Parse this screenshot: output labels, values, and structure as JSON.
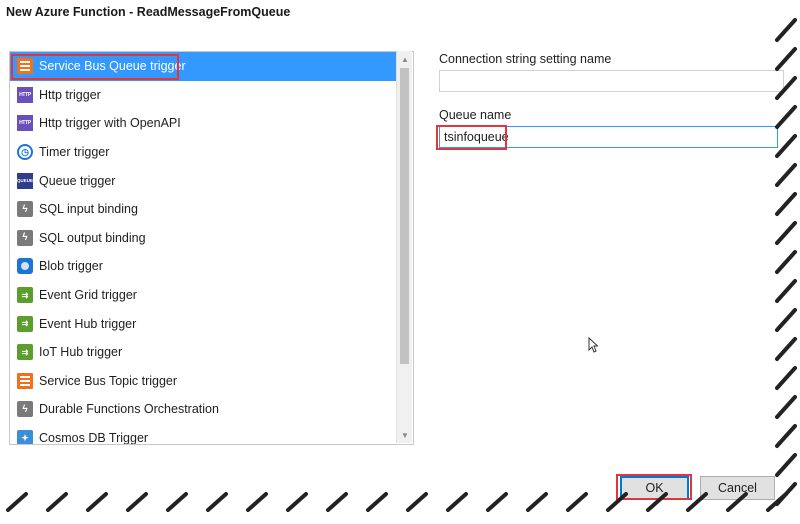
{
  "dialog": {
    "title": "New Azure Function - ReadMessageFromQueue"
  },
  "trigger_list": {
    "selected_index": 0,
    "items": [
      {
        "label": "Service Bus Queue trigger",
        "icon": "service-bus-icon"
      },
      {
        "label": "Http trigger",
        "icon": "http-icon"
      },
      {
        "label": "Http trigger with OpenAPI",
        "icon": "http-icon"
      },
      {
        "label": "Timer trigger",
        "icon": "timer-icon"
      },
      {
        "label": "Queue trigger",
        "icon": "queue-icon"
      },
      {
        "label": "SQL input binding",
        "icon": "sql-icon"
      },
      {
        "label": "SQL output binding",
        "icon": "sql-icon"
      },
      {
        "label": "Blob trigger",
        "icon": "blob-icon"
      },
      {
        "label": "Event Grid trigger",
        "icon": "event-grid-icon"
      },
      {
        "label": "Event Hub trigger",
        "icon": "event-hub-icon"
      },
      {
        "label": "IoT Hub trigger",
        "icon": "iot-hub-icon"
      },
      {
        "label": "Service Bus Topic trigger",
        "icon": "service-bus-icon"
      },
      {
        "label": "Durable Functions Orchestration",
        "icon": "durable-functions-icon"
      },
      {
        "label": "Cosmos DB Trigger",
        "icon": "cosmos-db-icon"
      }
    ]
  },
  "settings": {
    "connection_label": "Connection string setting name",
    "connection_value": "",
    "queue_label": "Queue name",
    "queue_value": "tsinfoqueue"
  },
  "buttons": {
    "ok": "OK",
    "cancel": "Cancel"
  },
  "colors": {
    "selection": "#3399ff",
    "highlight_box": "#e0373c"
  }
}
